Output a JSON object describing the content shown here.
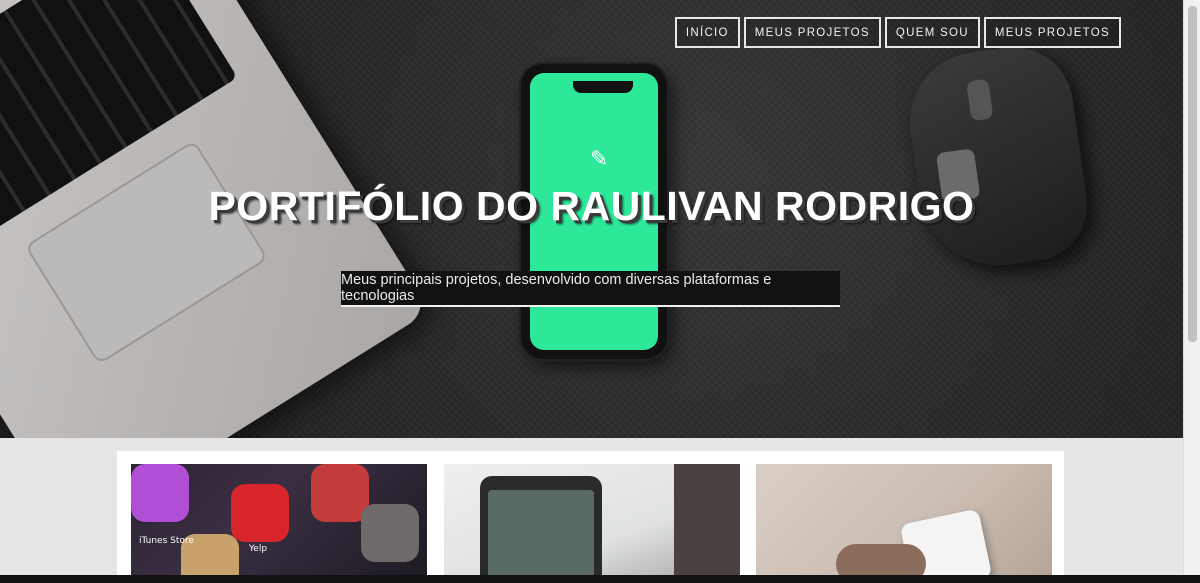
{
  "nav": {
    "items": [
      "INÍCIO",
      "MEUS PROJETOS",
      "QUEM SOU",
      "MEUS PROJETOS"
    ]
  },
  "hero": {
    "title": "PORTIFÓLIO DO RAULIVAN RODRIGO",
    "subtitle": "Meus principais projetos, desenvolvido com diversas plataformas e tecnologias"
  },
  "projects": {
    "card1_labels": [
      "iTunes Store",
      "Yelp"
    ]
  },
  "colors": {
    "phone_screen": "#2ee89a",
    "hero_bg": "#2b2a29",
    "page_bg": "#e6e6e6"
  },
  "icons": [
    "feather-icon"
  ]
}
